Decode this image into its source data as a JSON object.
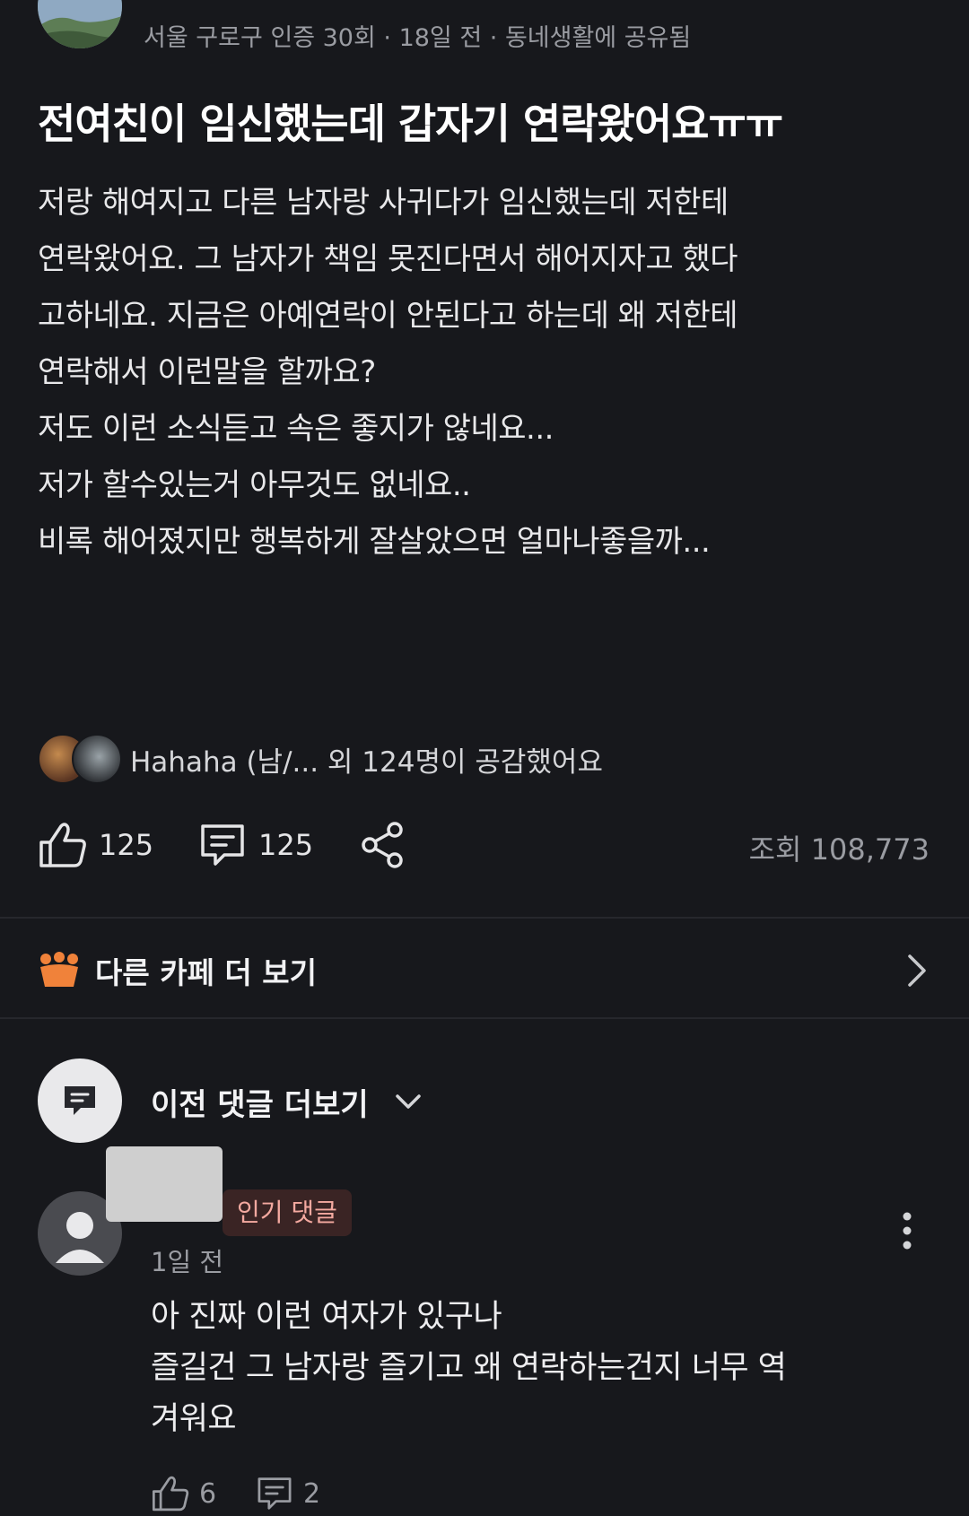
{
  "post": {
    "meta": "서울 구로구 인증 30회 · 18일 전 · 동네생활에 공유됨",
    "title": "전여친이 임신했는데 갑자기 연락왔어요ㅠㅠ",
    "body_lines": [
      "저랑 해여지고 다른 남자랑 사귀다가 임신했는데 저한테",
      "연락왔어요. 그 남자가 책임 못진다면서 해어지자고 했다",
      "고하네요. 지금은 아예연락이 안된다고 하는데 왜 저한테",
      "연락해서 이런말을 할까요?",
      "저도 이런 소식듣고 속은 좋지가 않네요...",
      "저가 할수있는거 아무것도 없네요..",
      "비록 해어졌지만 행복하게 잘살았으면 얼마나좋을까..."
    ]
  },
  "empathy": {
    "text": "Hahaha (남/... 외 124명이 공감했어요"
  },
  "actions": {
    "likes": "125",
    "comments": "125",
    "views": "조회 108,773"
  },
  "other_cafes": {
    "label": "다른 카페 더 보기"
  },
  "comments_section": {
    "prev_label": "이전 댓글 더보기"
  },
  "comment": {
    "badge": "인기 댓글",
    "time": "1일 전",
    "lines": [
      "아 진짜 이런 여자가 있구나",
      "즐길건 그 남자랑 즐기고 왜 연락하는건지 너무 역",
      "겨워요"
    ],
    "likes": "6",
    "replies": "2"
  },
  "colors": {
    "background": "#17181c",
    "cafe_icon": "#f0823a",
    "badge_bg": "#3a2424",
    "badge_text": "#f4a9a0"
  }
}
